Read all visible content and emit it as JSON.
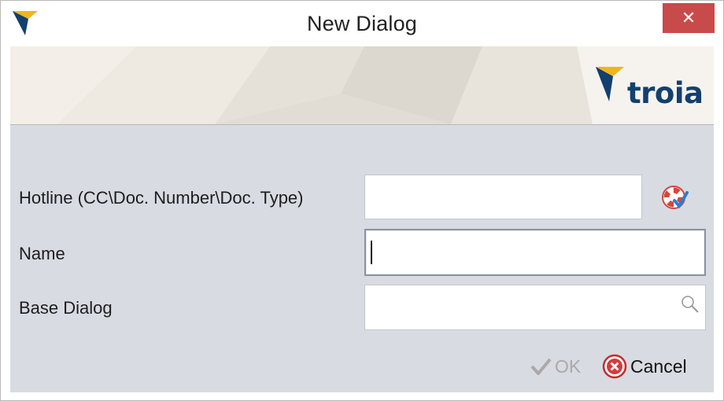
{
  "window": {
    "title": "New Dialog",
    "close_symbol": "✕"
  },
  "banner": {
    "brand": "troia"
  },
  "form": {
    "hotline": {
      "label": "Hotline (CC\\Doc. Number\\Doc. Type)",
      "value": "",
      "help_icon": "lifebuoy-check-icon"
    },
    "name": {
      "label": "Name",
      "value": ""
    },
    "base_dialog": {
      "label": "Base Dialog",
      "value": "",
      "search_icon": "search-icon"
    }
  },
  "buttons": {
    "ok": {
      "label": "OK",
      "enabled": false,
      "icon": "check-icon"
    },
    "cancel": {
      "label": "Cancel",
      "icon": "cancel-circle-icon"
    }
  },
  "colors": {
    "close_button": "#c94a4a",
    "brand_blue": "#13406e",
    "brand_yellow": "#f1b51c",
    "content_bg": "#d8dbe2"
  }
}
